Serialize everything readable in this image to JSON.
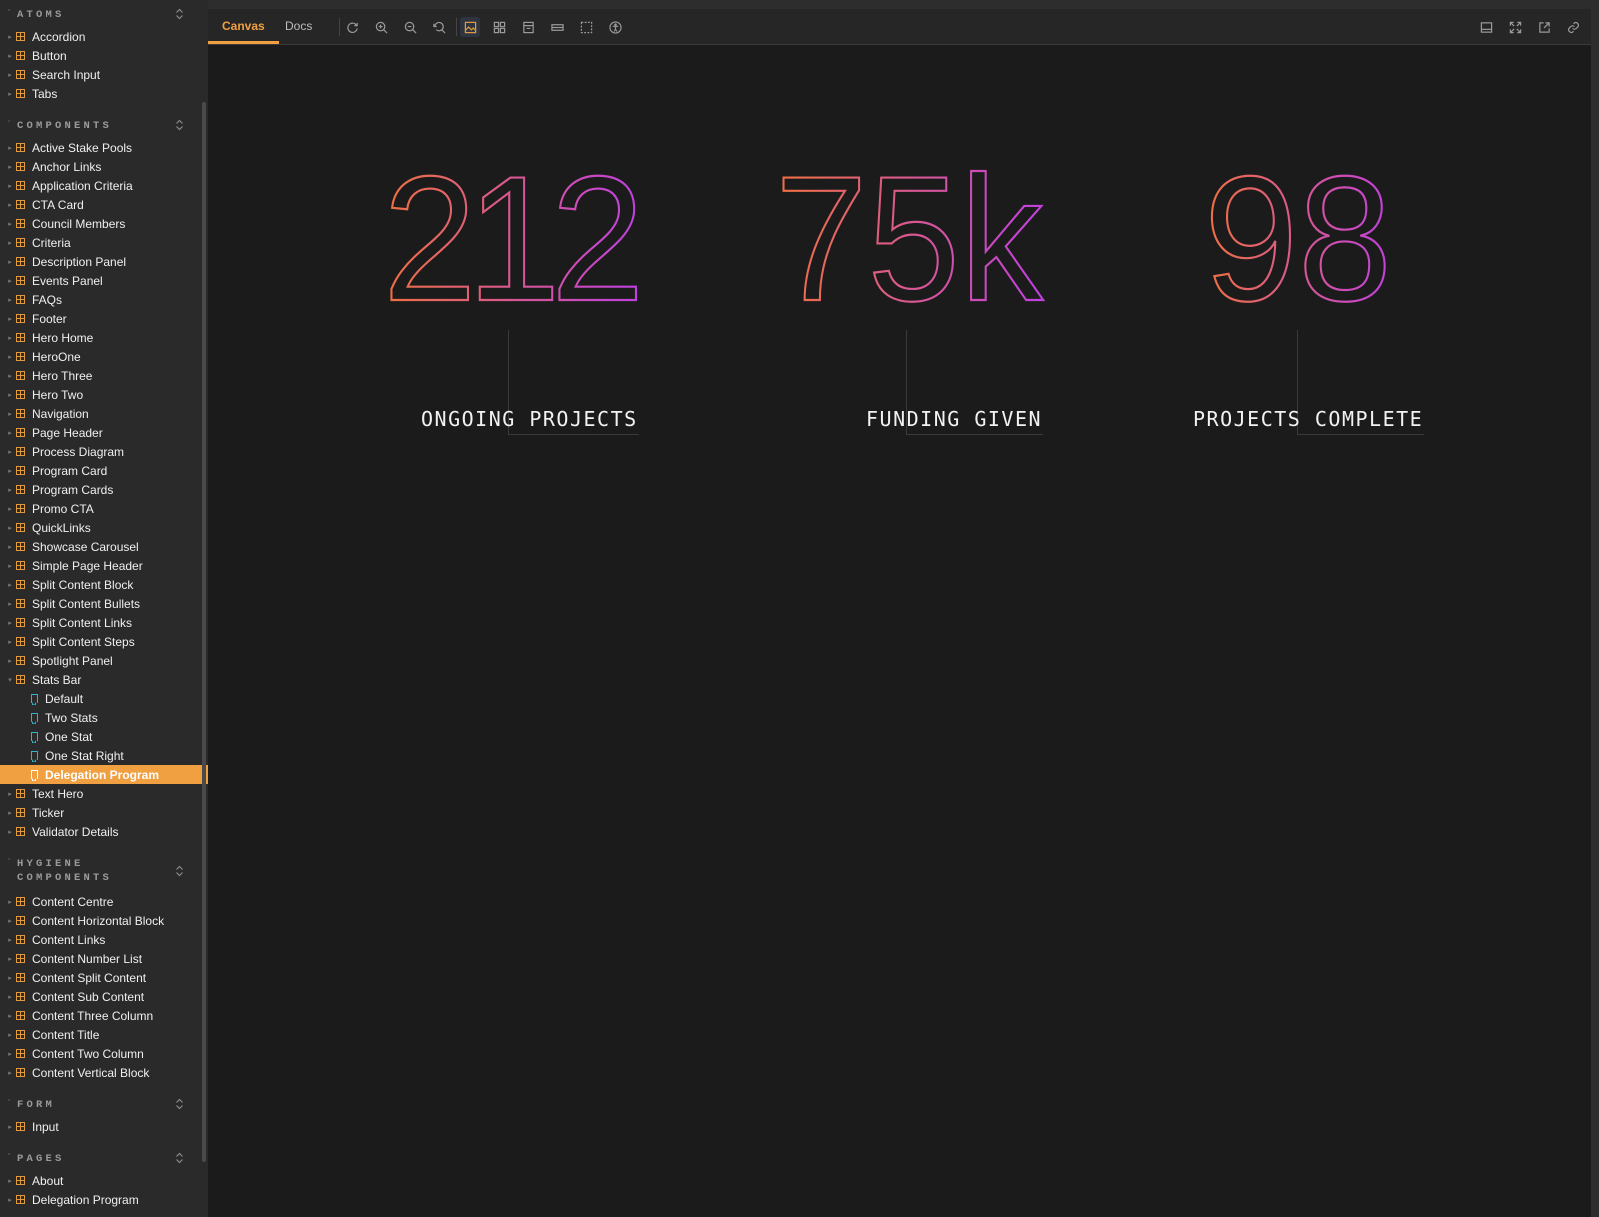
{
  "sidebar": {
    "sections": [
      {
        "title": "ATOMS",
        "items": [
          "Accordion",
          "Button",
          "Search Input",
          "Tabs"
        ]
      },
      {
        "title": "COMPONENTS",
        "items": [
          "Active Stake Pools",
          "Anchor Links",
          "Application Criteria",
          "CTA Card",
          "Council Members",
          "Criteria",
          "Description Panel",
          "Events Panel",
          "FAQs",
          "Footer",
          "Hero Home",
          "HeroOne",
          "Hero Three",
          "Hero Two",
          "Navigation",
          "Page Header",
          "Process Diagram",
          "Program Card",
          "Program Cards",
          "Promo CTA",
          "QuickLinks",
          "Showcase Carousel",
          "Simple Page Header",
          "Split Content Block",
          "Split Content Bullets",
          "Split Content Links",
          "Split Content Steps",
          "Spotlight Panel",
          "Stats Bar",
          "Text Hero",
          "Ticker",
          "Validator Details"
        ]
      },
      {
        "title": "HYGIENE COMPONENTS",
        "items": [
          "Content Centre",
          "Content Horizontal Block",
          "Content Links",
          "Content Number List",
          "Content Split Content",
          "Content Sub Content",
          "Content Three Column",
          "Content Title",
          "Content Two Column",
          "Content Vertical Block"
        ]
      },
      {
        "title": "FORM",
        "items": [
          "Input"
        ]
      },
      {
        "title": "PAGES",
        "items": [
          "About",
          "Delegation Program"
        ]
      }
    ],
    "expanded_component": "Stats Bar",
    "stories": [
      "Default",
      "Two Stats",
      "One Stat",
      "One Stat Right",
      "Delegation Program"
    ],
    "selected_story": "Delegation Program"
  },
  "toolbar": {
    "tabs": [
      "Canvas",
      "Docs"
    ],
    "active_tab": "Canvas",
    "tools": [
      "reload-icon",
      "zoom-in-icon",
      "zoom-out-icon",
      "zoom-reset-icon",
      "background-icon",
      "grid-icon",
      "viewport-icon",
      "measure-icon",
      "outline-icon",
      "accessibility-icon"
    ],
    "right_tools": [
      "panel-icon",
      "fullscreen-icon",
      "open-new-tab-icon",
      "copy-link-icon"
    ]
  },
  "stats": [
    {
      "value": "212",
      "label": "ONGOING PROJECTS"
    },
    {
      "value": "75k",
      "label": "FUNDING GIVEN"
    },
    {
      "value": "98",
      "label": "PROJECTS COMPLETE"
    }
  ],
  "colors": {
    "accent": "#f0a040",
    "gradient_start": "#f07040",
    "gradient_end": "#c040e0",
    "story_icon": "#2fb4c8"
  }
}
